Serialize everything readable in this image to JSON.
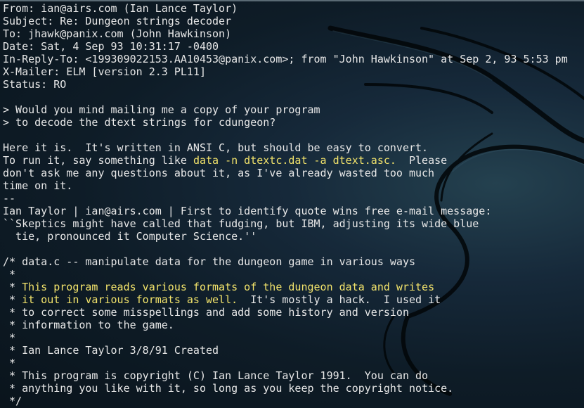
{
  "theme": {
    "text_color": "#e8e8e8",
    "highlight_color": "#f2e36b",
    "background": "#0e1c27",
    "wallpaper": "kali-dragon-icon"
  },
  "lines": [
    [
      {
        "t": "From: ian@airs.com (Ian Lance Taylor)"
      }
    ],
    [
      {
        "t": "Subject: Re: Dungeon strings decoder"
      }
    ],
    [
      {
        "t": "To: jhawk@panix.com (John Hawkinson)"
      }
    ],
    [
      {
        "t": "Date: Sat, 4 Sep 93 10:31:17 -0400"
      }
    ],
    [
      {
        "t": "In-Reply-To: <199309022153.AA10453@panix.com>; from \"John Hawkinson\" at Sep 2, 93 5:53 pm"
      }
    ],
    [
      {
        "t": "X-Mailer: ELM [version 2.3 PL11]"
      }
    ],
    [
      {
        "t": "Status: RO"
      }
    ],
    [
      {
        "t": ""
      }
    ],
    [
      {
        "t": "> Would you mind mailing me a copy of your program"
      }
    ],
    [
      {
        "t": "> to decode the dtext strings for cdungeon?"
      }
    ],
    [
      {
        "t": ""
      }
    ],
    [
      {
        "t": "Here it is.  It's written in ANSI C, but should be easy to convert."
      }
    ],
    [
      {
        "t": "To run it, say something like "
      },
      {
        "t": "data -n dtextc.dat -a dtext.asc.",
        "hl": true
      },
      {
        "t": "  Please"
      }
    ],
    [
      {
        "t": "don't ask me any questions about it, as I've already wasted too much"
      }
    ],
    [
      {
        "t": "time on it."
      }
    ],
    [
      {
        "t": "--"
      }
    ],
    [
      {
        "t": "Ian Taylor | ian@airs.com | First to identify quote wins free e-mail message:"
      }
    ],
    [
      {
        "t": "``Skeptics might have called that fudging, but IBM, adjusting its wide blue"
      }
    ],
    [
      {
        "t": "  tie, pronounced it Computer Science.''"
      }
    ],
    [
      {
        "t": ""
      }
    ],
    [
      {
        "t": "/* data.c -- manipulate data for the dungeon game in various ways"
      }
    ],
    [
      {
        "t": " *"
      }
    ],
    [
      {
        "t": " * "
      },
      {
        "t": "This program reads various formats of the dungeon data and writes",
        "hl": true
      }
    ],
    [
      {
        "t": " * "
      },
      {
        "t": "it out in various formats as well.",
        "hl": true
      },
      {
        "t": "  It's mostly a hack.  I used it"
      }
    ],
    [
      {
        "t": " * to correct some misspellings and add some history and version"
      }
    ],
    [
      {
        "t": " * information to the game."
      }
    ],
    [
      {
        "t": " *"
      }
    ],
    [
      {
        "t": " * Ian Lance Taylor 3/8/91 Created"
      }
    ],
    [
      {
        "t": " *"
      }
    ],
    [
      {
        "t": " * This program is copyright (C) Ian Lance Taylor 1991.  You can do"
      }
    ],
    [
      {
        "t": " * anything you like with it, so long as you keep the copyright notice."
      }
    ],
    [
      {
        "t": " */"
      }
    ]
  ]
}
